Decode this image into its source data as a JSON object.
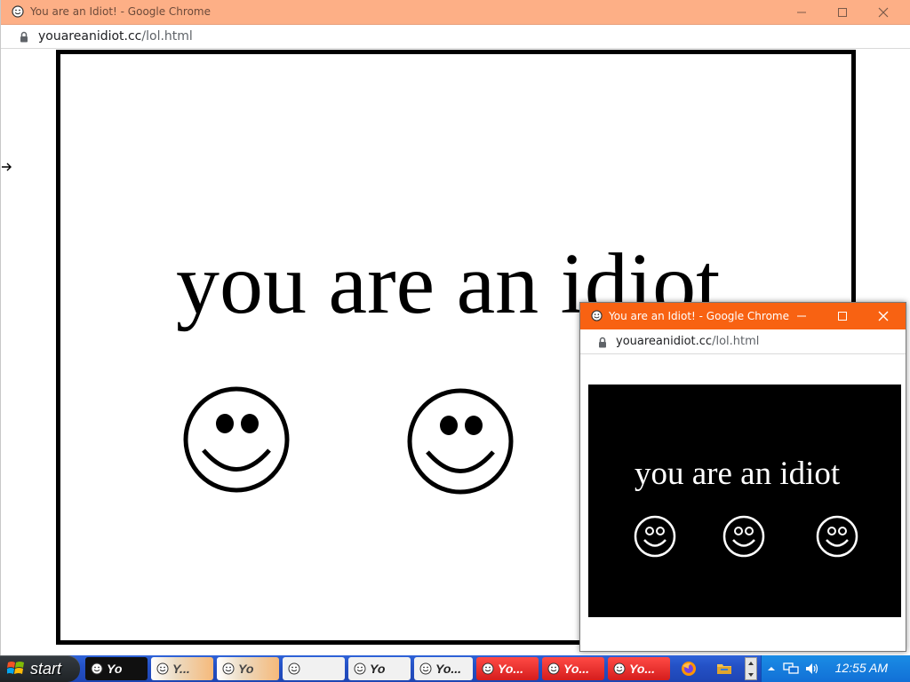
{
  "main_window": {
    "title": "You are an Idiot! - Google Chrome",
    "url_domain": "youareanidiot.cc",
    "url_path": "/lol.html",
    "content_text": "you are an idiot",
    "titlebar_color": "#fdaf86"
  },
  "popup_window": {
    "title": "You are an Idiot! - Google Chrome",
    "url_domain": "youareanidiot.cc",
    "url_path": "/lol.html",
    "content_text": "you are an idiot",
    "titlebar_color": "#f86212"
  },
  "taskbar": {
    "start_label": "start",
    "items": [
      {
        "label": "Yo",
        "style": "dark"
      },
      {
        "label": "Y...",
        "style": "lightg"
      },
      {
        "label": "Yo",
        "style": "lightg"
      },
      {
        "label": "",
        "style": "light"
      },
      {
        "label": "Yo",
        "style": "light"
      },
      {
        "label": "Yo...",
        "style": "light"
      },
      {
        "label": "Yo...",
        "style": "red"
      },
      {
        "label": "Yo...",
        "style": "red"
      },
      {
        "label": "Yo...",
        "style": "red"
      }
    ],
    "clock": "12:55 AM"
  }
}
